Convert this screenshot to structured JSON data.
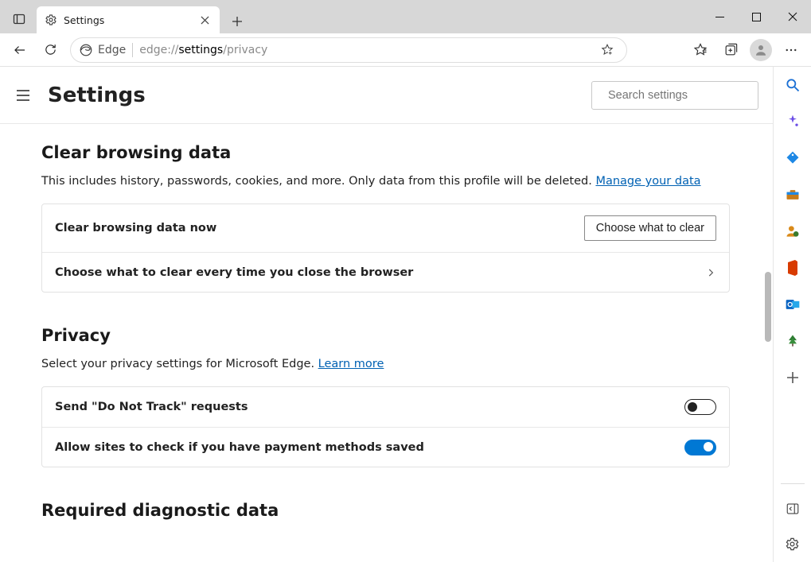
{
  "window": {
    "tab_label": "Settings",
    "addr_source": "Edge",
    "url_pre": "edge://",
    "url_bold": "settings",
    "url_post": "/privacy"
  },
  "settings": {
    "title": "Settings",
    "search_placeholder": "Search settings"
  },
  "sections": {
    "clear": {
      "title": "Clear browsing data",
      "desc": "This includes history, passwords, cookies, and more. Only data from this profile will be deleted. ",
      "link": "Manage your data",
      "row1_label": "Clear browsing data now",
      "row1_button": "Choose what to clear",
      "row2_label": "Choose what to clear every time you close the browser"
    },
    "privacy": {
      "title": "Privacy",
      "desc": "Select your privacy settings for Microsoft Edge. ",
      "link": "Learn more",
      "row1_label": "Send \"Do Not Track\" requests",
      "row2_label": "Allow sites to check if you have payment methods saved"
    },
    "diag": {
      "title": "Required diagnostic data"
    }
  }
}
